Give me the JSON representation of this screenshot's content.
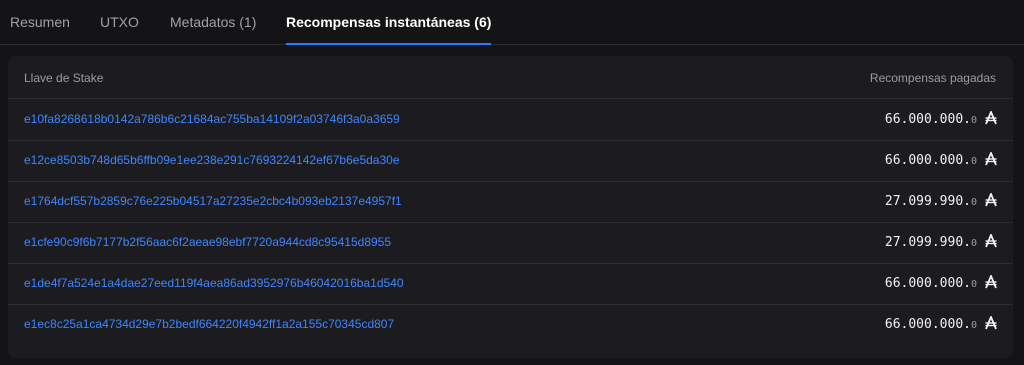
{
  "tabs": [
    {
      "label": "Resumen"
    },
    {
      "label": "UTXO"
    },
    {
      "label": "Metadatos (1)"
    },
    {
      "label": "Recompensas instantáneas (6)"
    }
  ],
  "table": {
    "columns": {
      "stake_key": "Llave de Stake",
      "rewards": "Recompensas pagadas"
    },
    "currency_icon": "ada-icon",
    "rows": [
      {
        "stake_key": "e10fa8268618b0142a786b6c21684ac755ba14109f2a03746f3a0a3659",
        "amount_int": "66.000.000.",
        "amount_dec": "0"
      },
      {
        "stake_key": "e12ce8503b748d65b6ffb09e1ee238e291c7693224142ef67b6e5da30e",
        "amount_int": "66.000.000.",
        "amount_dec": "0"
      },
      {
        "stake_key": "e1764dcf557b2859c76e225b04517a27235e2cbc4b093eb2137e4957f1",
        "amount_int": "27.099.990.",
        "amount_dec": "0"
      },
      {
        "stake_key": "e1cfe90c9f6b7177b2f56aac6f2aeae98ebf7720a944cd8c95415d8955",
        "amount_int": "27.099.990.",
        "amount_dec": "0"
      },
      {
        "stake_key": "e1de4f7a524e1a4dae27eed119f4aea86ad3952976b46042016ba1d540",
        "amount_int": "66.000.000.",
        "amount_dec": "0"
      },
      {
        "stake_key": "e1ec8c25a1ca4734d29e7b2bedf664220f4942ff1a2a155c70345cd807",
        "amount_int": "66.000.000.",
        "amount_dec": "0"
      }
    ]
  },
  "colors": {
    "accent": "#2e79ff",
    "link": "#3d86ff",
    "background": "#141416",
    "panel": "#1c1c20"
  }
}
